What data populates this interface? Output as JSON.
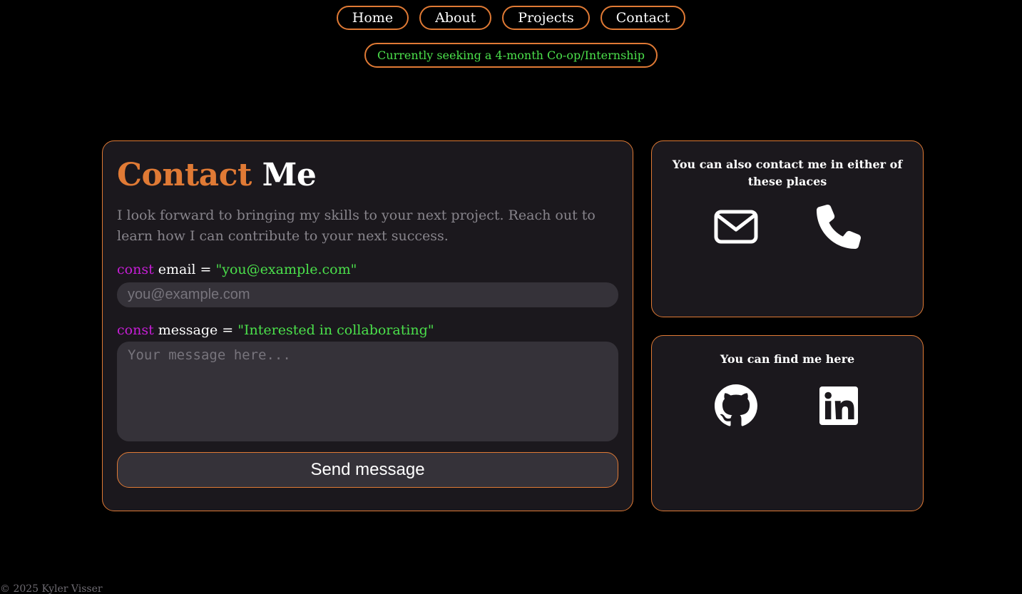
{
  "nav": {
    "items": [
      {
        "label": "Home"
      },
      {
        "label": "About"
      },
      {
        "label": "Projects"
      },
      {
        "label": "Contact"
      }
    ]
  },
  "banner": {
    "text": "Currently seeking a 4-month Co-op/Internship"
  },
  "contact_form": {
    "title_accent": "Contact",
    "title_rest": "Me",
    "description": "I look forward to bringing my skills to your next project. Reach out to learn how I can contribute to your next success.",
    "email_label": {
      "keyword": "const",
      "name": "email",
      "equals": "=",
      "value": "\"you@example.com\""
    },
    "email_placeholder": "you@example.com",
    "message_label": {
      "keyword": "const",
      "name": "message",
      "equals": "=",
      "value": "\"Interested in collaborating\""
    },
    "message_placeholder": "Your message here...",
    "send_label": "Send message"
  },
  "contact_places": {
    "heading": "You can also contact me in either of these places",
    "icons": [
      "envelope-icon",
      "phone-icon"
    ]
  },
  "find_me": {
    "heading": "You can find me here",
    "icons": [
      "github-icon",
      "linkedin-icon"
    ]
  },
  "footer": {
    "text": "© 2025 Kyler Visser"
  },
  "colors": {
    "background": "#000000",
    "card": "#1b181d",
    "accent": "#e07a35",
    "green": "#4be04b",
    "keyword": "#c61ed6",
    "input": "#353239",
    "muted": "#87848b"
  }
}
